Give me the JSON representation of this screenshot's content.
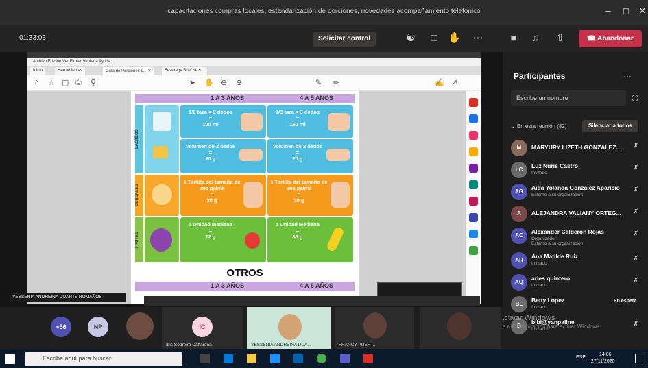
{
  "window": {
    "title": "capacitaciones compras locales, estandarización de porciones, novedades acompañamiento telefónico",
    "minimize": "–",
    "maximize": "◻",
    "close": "✕"
  },
  "meeting_bar": {
    "timer": "01:33:03",
    "request_control": "Solicitar control",
    "leave": "Abandonar"
  },
  "shared_doc": {
    "menubar": "Archivo  Edición  Ver  Firmar  Ventana  Ayuda",
    "tabs": [
      "Inicio",
      "Herramientas",
      "Guía de Porciones L... ✕",
      "Beverage Brief de s..."
    ],
    "header_age_1": "1 A 3 AÑOS",
    "header_age_2": "4 A 5 AÑOS",
    "row1_label": "LÁCTEOS",
    "cell_milk_1": "1/2 taza = 2 dedos\n=\n100 ml",
    "cell_milk_2": "1/3 taza = 3 dedos\n=\n150 ml",
    "cell_cheese_1": "Volumen de 2 dedos\n=\n20 g",
    "cell_cheese_2": "Volumen de 2 dedos\n=\n20 g",
    "row2_label": "CEREALES",
    "cell_tortilla_1": "1 Tortilla del tamaño de una palma\n=\n30 g",
    "cell_tortilla_2": "1 Tortilla del tamaño de una palma\n=\n30 g",
    "row3_label": "FRUTAS",
    "cell_fruit_1": "1 Unidad Mediana\n=\n72 g",
    "cell_fruit_2": "1 Unidad Mediana\n=\n85 g",
    "otros": "OTROS",
    "footer_age_1": "1 A 3 AÑOS",
    "footer_age_2": "4 A 5 AÑOS"
  },
  "presenter_tag": "YESSENIA ANDREINA DUARTE ROMAÑOS",
  "panel": {
    "title": "Participantes",
    "more": "···",
    "search_placeholder": "Escribe un nombre",
    "section": "⌄ En esta reunión (82)",
    "mute_all": "Silenciar a todos",
    "participants": [
      {
        "name": "MARYURY LIZETH GONZALEZ...",
        "role": "",
        "initials": "M",
        "color": "#8a6a5a"
      },
      {
        "name": "Luz Nuris Castro",
        "role": "Invitado",
        "initials": "LC",
        "color": "#6b6b6b"
      },
      {
        "name": "Aida Yolanda Gonzalez Aparicio",
        "role": "Externo a su organización",
        "initials": "AG",
        "color": "#4f52b2"
      },
      {
        "name": "ALEJANDRA VALIANY ORTEG...",
        "role": "",
        "initials": "A",
        "color": "#7a4a4a"
      },
      {
        "name": "Alexander Calderon Rojas",
        "role": "Organizador\nExterno a su organización",
        "initials": "AC",
        "color": "#4f52b2"
      },
      {
        "name": "Ana Matilde Ruiz",
        "role": "Invitado",
        "initials": "AR",
        "color": "#4f52b2"
      },
      {
        "name": "aries quintero",
        "role": "Invitado",
        "initials": "AQ",
        "color": "#4f52b2"
      },
      {
        "name": "Betty Lopez",
        "role": "Invitado",
        "initials": "BL",
        "color": "#6b6b6b",
        "status": "En espera"
      },
      {
        "name": "bibi@yanpaline",
        "role": "Invitado",
        "initials": "B",
        "color": "#6b6b6b"
      }
    ]
  },
  "strip": {
    "overflow": "+56",
    "np": "NP",
    "ic": "IC",
    "name_1": "Ibis Sodreira Caffarena",
    "name_2": "YESSENIA ANDREINA DUA...",
    "name_3": "FRANCY PUERT..."
  },
  "watermark": {
    "line1": "Activar Windows",
    "line2": "Ve a Configuración para activar Windows."
  },
  "taskbar": {
    "search": "Escribe aquí para buscar",
    "time": "14:06",
    "date": "27/11/2020",
    "lang": "ESP"
  }
}
